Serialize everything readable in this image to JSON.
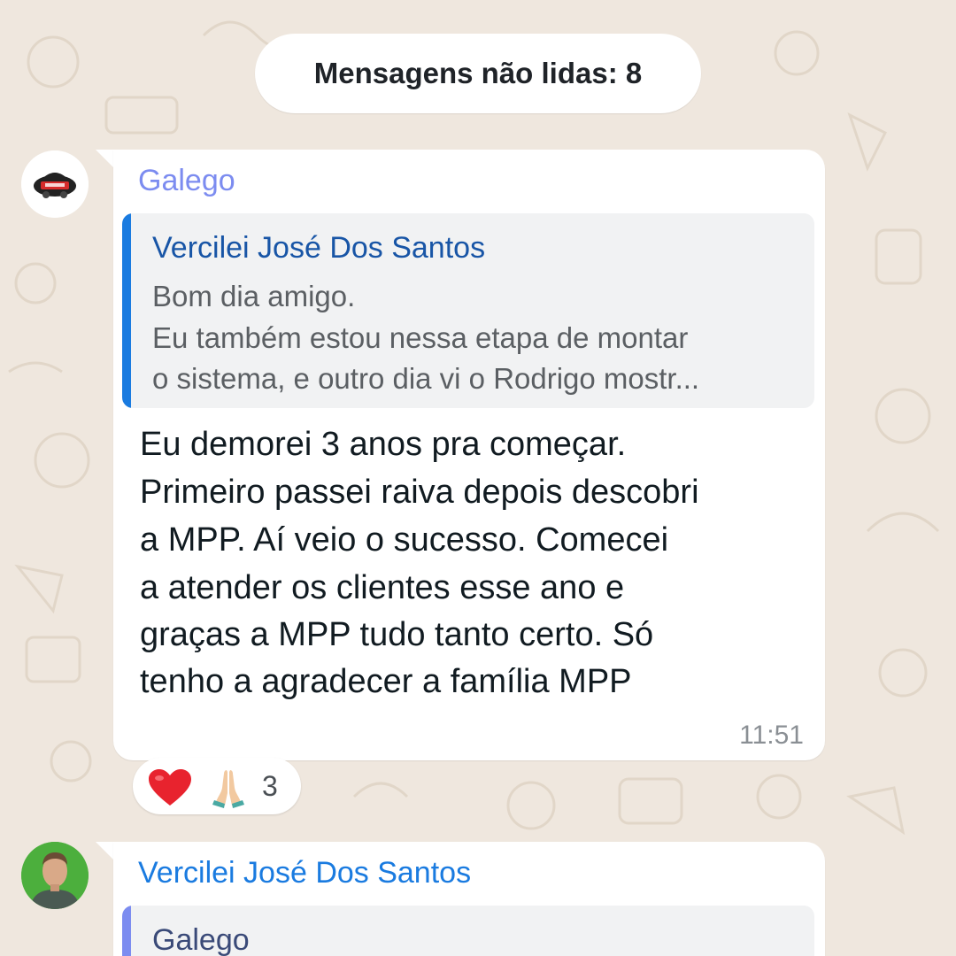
{
  "colors": {
    "wallpaper": "#efe7de",
    "bubble": "#ffffff",
    "quote_background": "#f1f2f3",
    "galego_name": "#7c8cf0",
    "vercilei_name": "#1a7be0",
    "quote_author": "#1855a6",
    "body_text": "#111b21",
    "timestamp": "#8a8f94"
  },
  "unread_banner": {
    "text": "Mensagens não lidas: 8"
  },
  "messages": [
    {
      "sender": "Galego",
      "avatar_icon": "car-logo-avatar",
      "quote": {
        "author": "Vercilei José Dos Santos",
        "lines": [
          "Bom dia amigo.",
          "Eu também estou nessa etapa de montar",
          "o sistema, e outro dia vi o Rodrigo mostr..."
        ]
      },
      "body_lines": [
        "Eu demorei 3 anos pra começar.",
        "Primeiro passei raiva depois descobri",
        "a MPP. Aí veio o sucesso. Comecei",
        "a atender os clientes esse ano e",
        "graças a MPP tudo tanto certo. Só",
        "tenho a agradecer a família MPP"
      ],
      "time": "11:51",
      "reactions": {
        "icons": [
          "heart-icon",
          "praying-hands-icon"
        ],
        "count": "3"
      }
    },
    {
      "sender": "Vercilei José Dos Santos",
      "avatar_icon": "person-photo-avatar",
      "quote": {
        "author": "Galego"
      }
    }
  ]
}
